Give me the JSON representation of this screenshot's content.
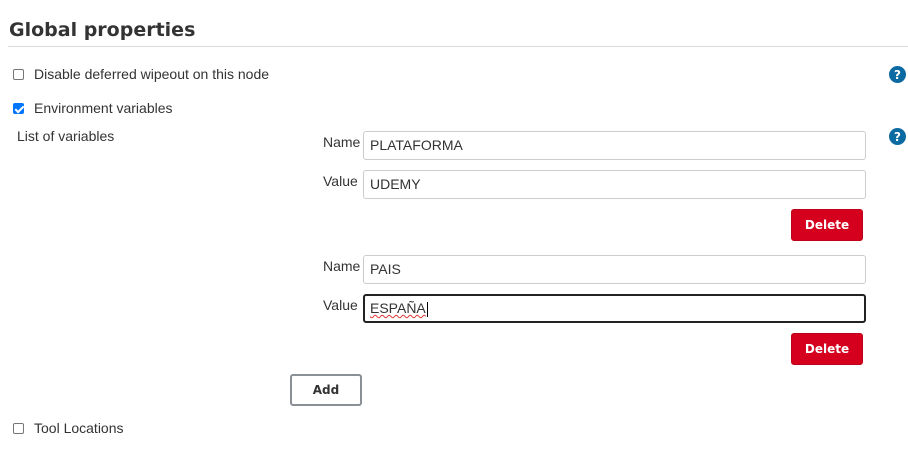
{
  "section": {
    "title": "Global properties"
  },
  "options": {
    "disable_wipeout": {
      "label": "Disable deferred wipeout on this node",
      "checked": false
    },
    "env_vars": {
      "label": "Environment variables",
      "checked": true
    },
    "tool_locations": {
      "label": "Tool Locations",
      "checked": false
    }
  },
  "env": {
    "list_label": "List of variables",
    "name_label": "Name",
    "value_label": "Value",
    "delete_label": "Delete",
    "add_label": "Add",
    "variables": [
      {
        "name": "PLATAFORMA",
        "value": "UDEMY"
      },
      {
        "name": "PAIS",
        "value": "ESPAÑA"
      }
    ]
  },
  "help": {
    "glyph": "?",
    "icon": "question-circle-icon",
    "color": "#0b6aa2"
  },
  "colors": {
    "delete_button": "#d4001e",
    "checkbox_checked": "#0075ff"
  }
}
